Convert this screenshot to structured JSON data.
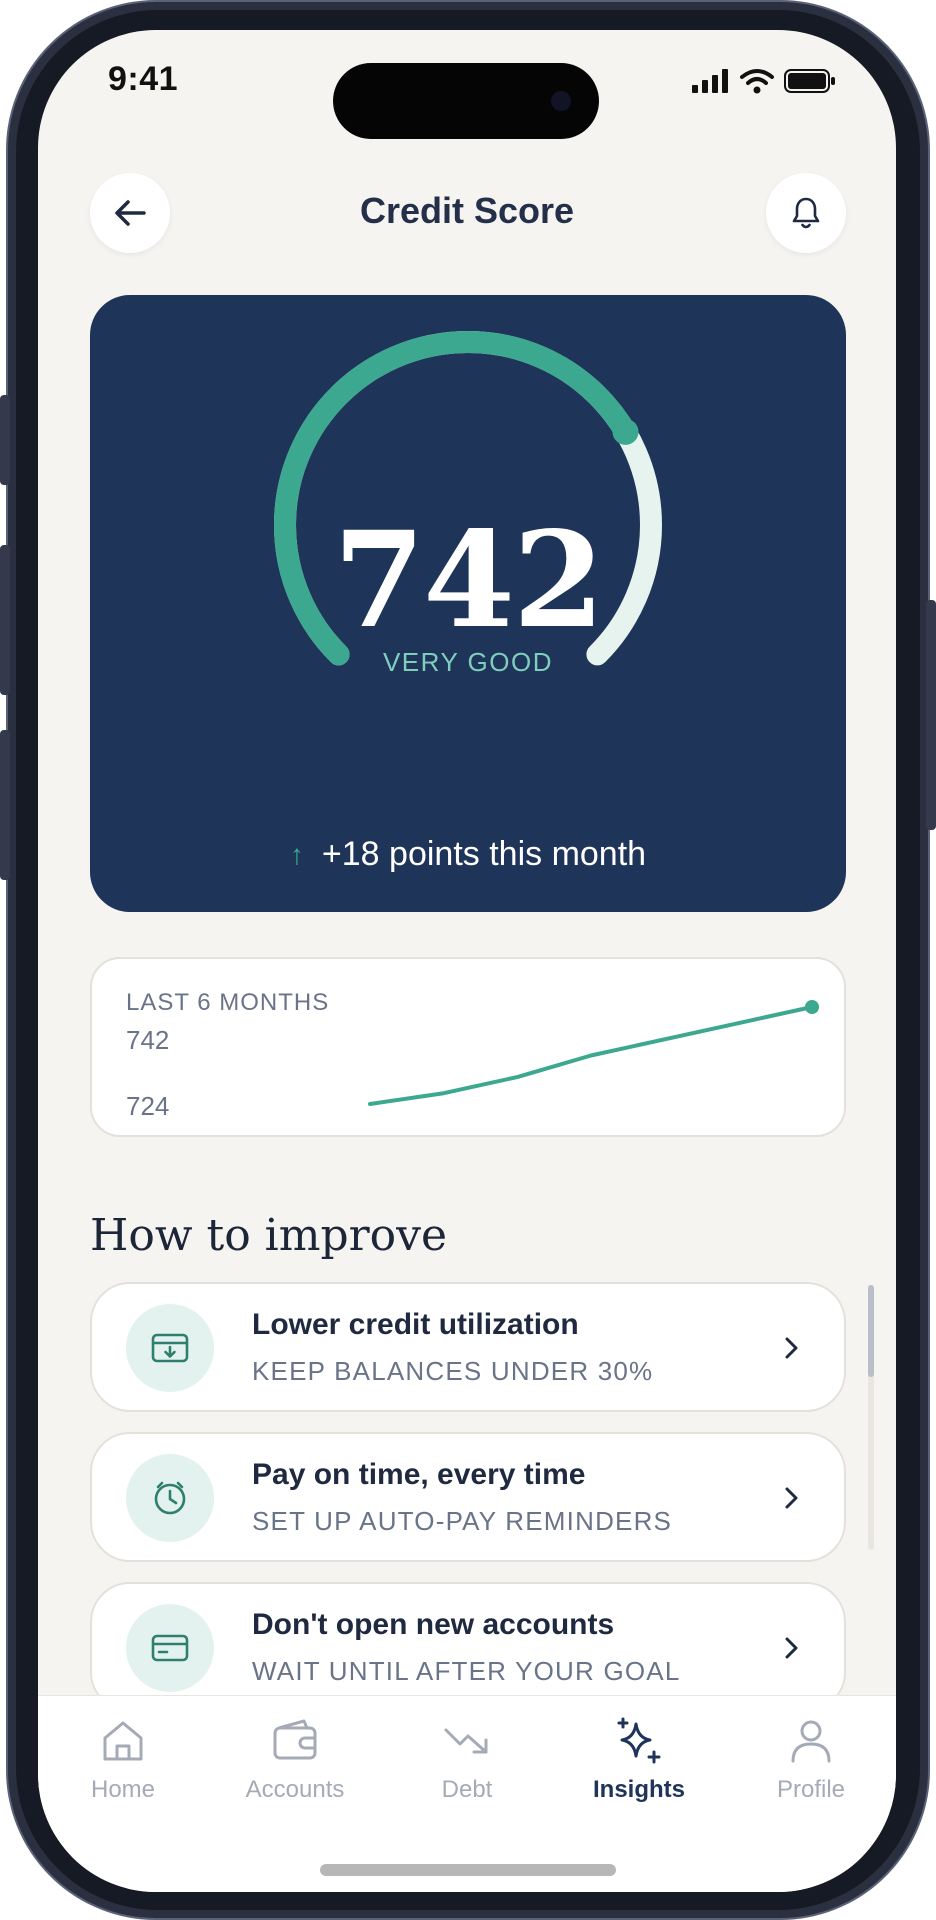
{
  "status_bar": {
    "time": "9:41"
  },
  "header": {
    "title": "Credit Score"
  },
  "score": {
    "value": "742",
    "rating": "VERY GOOD",
    "change_text": "+18 points this month",
    "gauge_fraction": 0.72,
    "colors": {
      "accent": "#3ba88f",
      "card_bg": "#1e3459",
      "track": "#e6f3ef"
    }
  },
  "trend": {
    "label": "LAST 6 MONTHS",
    "high": "742",
    "low": "724",
    "values": [
      724,
      726,
      729,
      733,
      736,
      739,
      742
    ]
  },
  "improve": {
    "title": "How to improve",
    "items": [
      {
        "title": "Lower credit utilization",
        "subtitle": "KEEP BALANCES UNDER 30%",
        "icon": "card-download-icon"
      },
      {
        "title": "Pay on time, every time",
        "subtitle": "SET UP AUTO-PAY REMINDERS",
        "icon": "clock-icon"
      },
      {
        "title": "Don't open new accounts",
        "subtitle": "WAIT UNTIL AFTER YOUR GOAL",
        "icon": "credit-card-icon"
      }
    ]
  },
  "tabs": [
    {
      "label": "Home",
      "icon": "home-icon"
    },
    {
      "label": "Accounts",
      "icon": "wallet-icon"
    },
    {
      "label": "Debt",
      "icon": "trend-down-icon"
    },
    {
      "label": "Insights",
      "icon": "sparkle-icon",
      "active": true
    },
    {
      "label": "Profile",
      "icon": "person-icon"
    }
  ]
}
